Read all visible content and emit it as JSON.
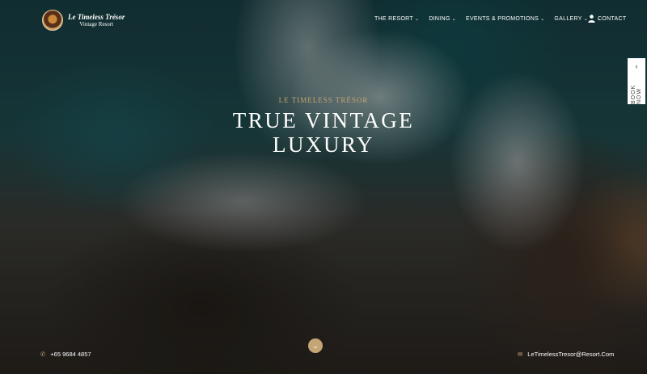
{
  "brand": {
    "name": "Le Timeless Trésor",
    "subtitle": "Vintage Resort"
  },
  "nav": [
    {
      "label": "THE RESORT",
      "has_dropdown": true
    },
    {
      "label": "DINING",
      "has_dropdown": true
    },
    {
      "label": "EVENTS & PROMOTIONS",
      "has_dropdown": true
    },
    {
      "label": "GALLERY",
      "has_dropdown": true
    },
    {
      "label": "CONTACT",
      "has_dropdown": false
    }
  ],
  "book_now": {
    "label": "BOOK NOW"
  },
  "hero": {
    "kicker": "LE TIMELESS TRÉSOR",
    "title_line1": "TRUE VINTAGE",
    "title_line2": "LUXURY"
  },
  "footer": {
    "phone": "+65 9684 4857",
    "email": "LeTimelessTresor@Resort.Com"
  },
  "icons": {
    "chevron": "chevron-down-icon",
    "user": "user-icon",
    "phone": "phone-icon",
    "email": "envelope-icon"
  },
  "colors": {
    "accent": "#c4a575",
    "kicker": "#c7a46f",
    "text": "#ffffff"
  }
}
